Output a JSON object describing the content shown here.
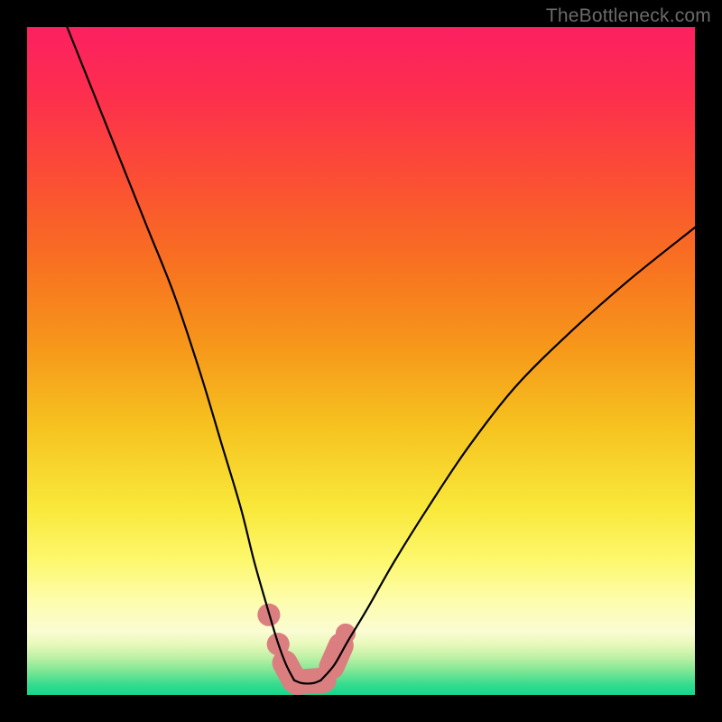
{
  "watermark": {
    "text": "TheBottleneck.com"
  },
  "colors": {
    "black": "#000000",
    "curve": "#000000",
    "pink_marker": "#db7e80",
    "gradient_stops": [
      {
        "offset": 0.0,
        "color": "#fc2061"
      },
      {
        "offset": 0.1,
        "color": "#fd2e4e"
      },
      {
        "offset": 0.22,
        "color": "#fb4c35"
      },
      {
        "offset": 0.35,
        "color": "#f87021"
      },
      {
        "offset": 0.48,
        "color": "#f6981a"
      },
      {
        "offset": 0.6,
        "color": "#f6c31f"
      },
      {
        "offset": 0.72,
        "color": "#f9e83a"
      },
      {
        "offset": 0.8,
        "color": "#fdf86e"
      },
      {
        "offset": 0.86,
        "color": "#fdfdad"
      },
      {
        "offset": 0.905,
        "color": "#fafcd2"
      },
      {
        "offset": 0.925,
        "color": "#e7f8ba"
      },
      {
        "offset": 0.945,
        "color": "#baf0a4"
      },
      {
        "offset": 0.965,
        "color": "#7ae695"
      },
      {
        "offset": 0.985,
        "color": "#34db8e"
      },
      {
        "offset": 1.0,
        "color": "#17d68b"
      }
    ]
  },
  "chart_data": {
    "type": "line",
    "title": "",
    "xlabel": "",
    "ylabel": "",
    "xlim": [
      0,
      100
    ],
    "ylim": [
      0,
      100
    ],
    "grid": false,
    "series": [
      {
        "name": "left-branch",
        "x": [
          6,
          10,
          14,
          18,
          22,
          26,
          29,
          32,
          34,
          36,
          37.5,
          38.8,
          40
        ],
        "y": [
          100,
          90,
          80,
          70,
          60,
          48,
          38,
          28,
          20,
          13,
          8,
          4.5,
          2.2
        ]
      },
      {
        "name": "right-branch",
        "x": [
          44,
          46,
          48,
          51,
          55,
          60,
          66,
          73,
          81,
          90,
          100
        ],
        "y": [
          2.2,
          4.5,
          8,
          13,
          20,
          28,
          37,
          46,
          54,
          62,
          70
        ]
      },
      {
        "name": "valley-floor",
        "x": [
          40,
          41,
          42,
          43,
          44
        ],
        "y": [
          2.2,
          1.8,
          1.7,
          1.8,
          2.2
        ]
      }
    ],
    "markers": [
      {
        "name": "left-dot-upper",
        "x": 36.2,
        "y": 12.0,
        "r": 1.7
      },
      {
        "name": "left-dot-mid",
        "x": 37.6,
        "y": 7.6,
        "r": 1.7
      },
      {
        "name": "left-pill",
        "x0": 38.6,
        "y0": 4.8,
        "x1": 40.0,
        "y1": 2.2,
        "r": 1.9
      },
      {
        "name": "floor-pill",
        "x0": 40.4,
        "y0": 1.9,
        "x1": 44.4,
        "y1": 2.2,
        "r": 1.9
      },
      {
        "name": "right-pill",
        "x0": 45.6,
        "y0": 4.2,
        "x1": 47.0,
        "y1": 7.4,
        "r": 1.9
      },
      {
        "name": "right-dot-upper",
        "x": 47.7,
        "y": 9.2,
        "r": 1.5
      }
    ]
  }
}
